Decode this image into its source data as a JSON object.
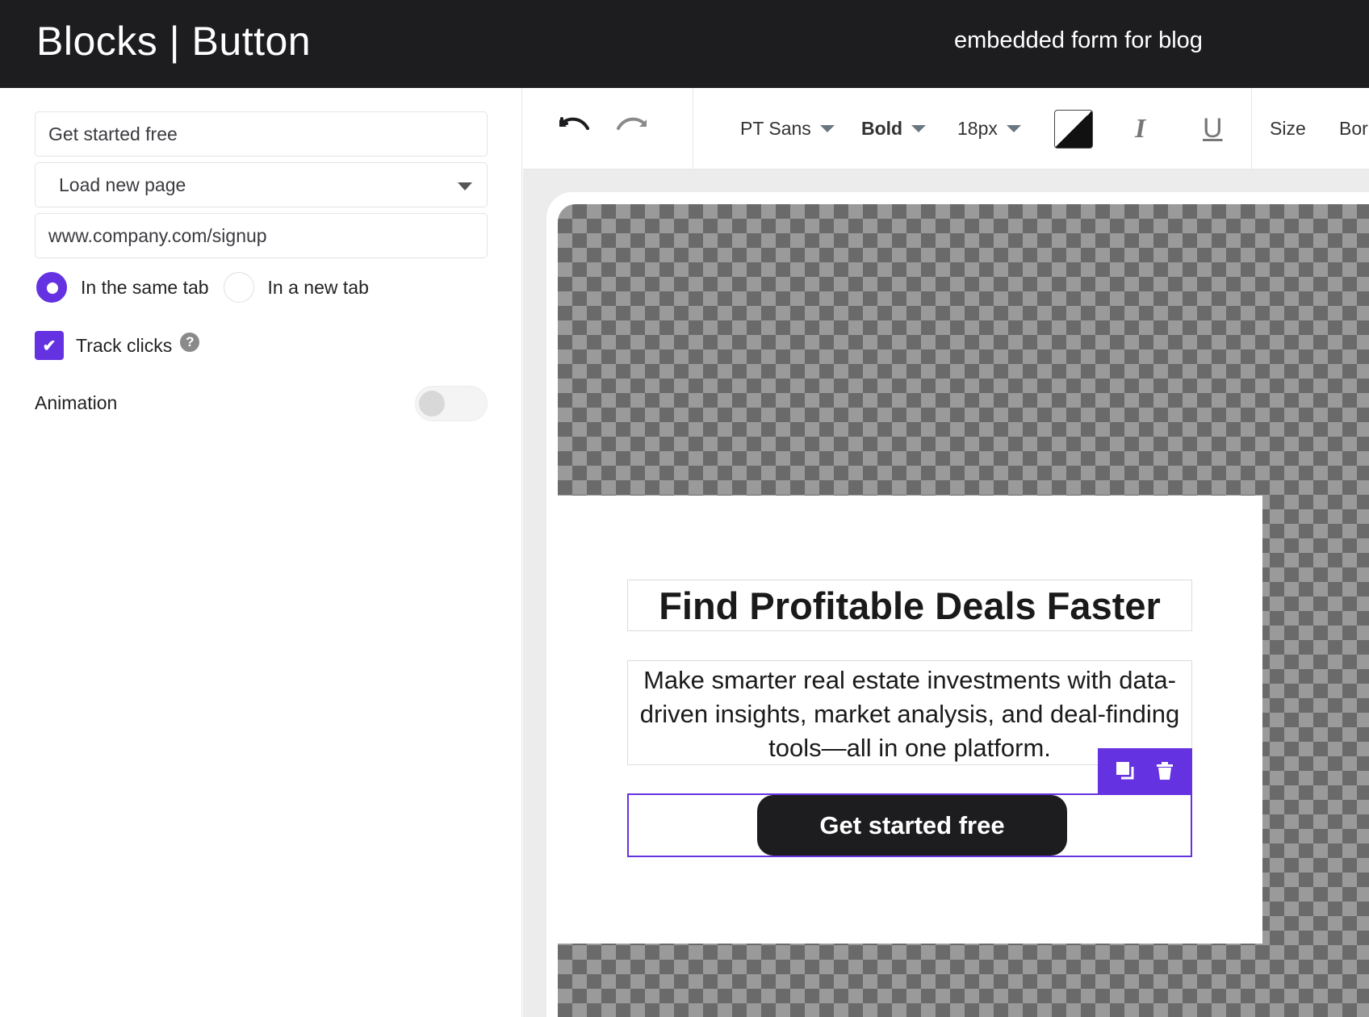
{
  "header": {
    "title": "Blocks | Button",
    "doc_name": "embedded form for blog"
  },
  "sidebar": {
    "button_text": "Get started free",
    "action": "Load new page",
    "url": "www.company.com/signup",
    "open_options": [
      {
        "label": "In the same tab",
        "selected": true
      },
      {
        "label": "In a new tab",
        "selected": false
      }
    ],
    "track_clicks": {
      "label": "Track clicks",
      "checked": true,
      "help": "?"
    },
    "animation": {
      "label": "Animation",
      "enabled": false
    }
  },
  "toolbar": {
    "undo_icon": "undo-icon",
    "redo_icon": "redo-icon",
    "font": "PT Sans",
    "weight": "Bold",
    "size": "18px",
    "italic": "I",
    "underline": "U",
    "size_label": "Size",
    "border_label": "Bor"
  },
  "canvas": {
    "headline": "Find Profitable Deals Faster",
    "body": "Make smarter real estate investments with data-driven insights, market analysis, and deal-finding tools—all in one platform.",
    "cta": "Get started free",
    "actions": [
      "duplicate-icon",
      "trash-icon"
    ]
  },
  "colors": {
    "accent": "#6432e0",
    "header_bg": "#1d1d20",
    "button_bg": "#1d1d20"
  }
}
